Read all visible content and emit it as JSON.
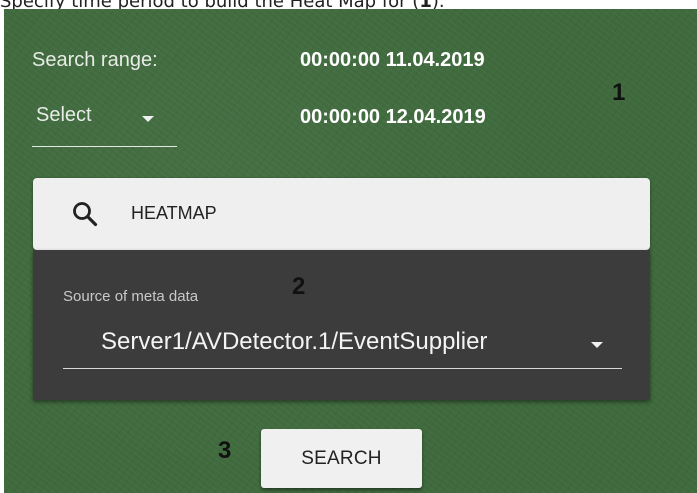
{
  "caption": {
    "text_before": "Specify time period to build the Heat Map for (",
    "text_bold": "1",
    "text_after": ")."
  },
  "period": {
    "range_label": "Search range:",
    "start": "00:00:00 11.04.2019",
    "select_label": "Select",
    "end": "00:00:00 12.04.2019"
  },
  "search": {
    "mode": "HEATMAP"
  },
  "meta": {
    "label": "Source of meta data",
    "value": "Server1/AVDetector.1/EventSupplier"
  },
  "button": {
    "label": "SEARCH"
  },
  "callouts": {
    "one": "1",
    "two": "2",
    "three": "3"
  },
  "colors": {
    "background": "#3f6a3d",
    "dark_panel": "#3c3c3c",
    "light_field": "#efefef"
  },
  "icons": {
    "search": "search-icon",
    "dropdown": "chevron-down-icon"
  }
}
